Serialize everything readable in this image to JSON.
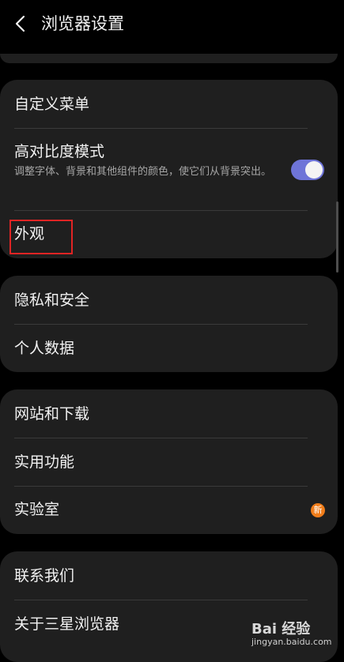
{
  "header": {
    "title": "浏览器设置"
  },
  "groups": [
    {
      "items": [
        {
          "label": "自定义菜单"
        },
        {
          "label": "高对比度模式",
          "description": "调整字体、背景和其他组件的颜色，使它们从背景突出。",
          "toggle": "on"
        },
        {
          "label": "外观"
        }
      ]
    },
    {
      "items": [
        {
          "label": "隐私和安全"
        },
        {
          "label": "个人数据"
        }
      ]
    },
    {
      "items": [
        {
          "label": "网站和下载"
        },
        {
          "label": "实用功能"
        },
        {
          "label": "实验室",
          "badge": "新"
        }
      ]
    },
    {
      "items": [
        {
          "label": "联系我们"
        },
        {
          "label": "关于三星浏览器"
        }
      ]
    }
  ],
  "watermark": {
    "line1": "Bai 经验",
    "line2": "jingyan.baidu.com"
  },
  "colors": {
    "background": "#000000",
    "card": "#1f1f1f",
    "toggle_on": "#6e74d8",
    "badge": "#f07d1a",
    "highlight": "#e02424"
  },
  "icons": {
    "back": "chevron-left-icon"
  }
}
